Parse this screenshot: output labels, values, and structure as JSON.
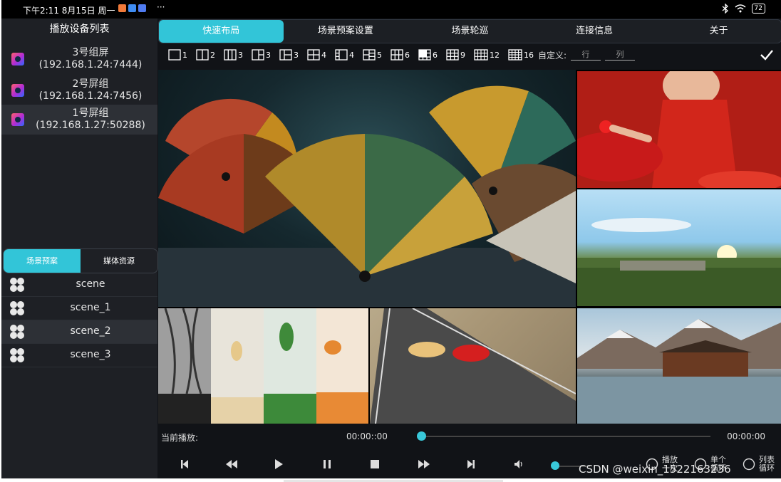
{
  "status_bar": {
    "time": "下午2:11 8月15日 周一",
    "more": "···",
    "battery": "72"
  },
  "left_panel": {
    "title": "播放设备列表",
    "devices": [
      {
        "name": "3号组屏",
        "address": "(192.168.1.24:7444)"
      },
      {
        "name": "2号屏组",
        "address": "(192.168.1.24:7456)"
      },
      {
        "name": "1号屏组",
        "address": "(192.168.1.27:50288)"
      }
    ],
    "tabs": [
      "场景预案",
      "媒体资源"
    ],
    "scenes": [
      "scene",
      "scene_1",
      "scene_2",
      "scene_3"
    ]
  },
  "top_tabs": [
    "快速布局",
    "场景预案设置",
    "场景轮巡",
    "连接信息",
    "关于"
  ],
  "layouts": {
    "items": [
      "1",
      "2",
      "3",
      "3",
      "3",
      "4",
      "4",
      "5",
      "6",
      "6",
      "9",
      "12",
      "16"
    ],
    "custom_label": "自定义:",
    "row_placeholder": "行",
    "col_placeholder": "列"
  },
  "player": {
    "current_label": "当前播放:",
    "time_start": "00:00::00",
    "time_end": "00:00:00",
    "progress": 0,
    "volume": 0,
    "modes": [
      {
        "label": "播放一次"
      },
      {
        "label": "单个循环"
      },
      {
        "label": "列表循环"
      }
    ]
  },
  "watermark": "CSDN @weixin_1522163236",
  "colors": {
    "accent": "#32c5d8",
    "panel": "#1e2025",
    "background": "#111317"
  }
}
